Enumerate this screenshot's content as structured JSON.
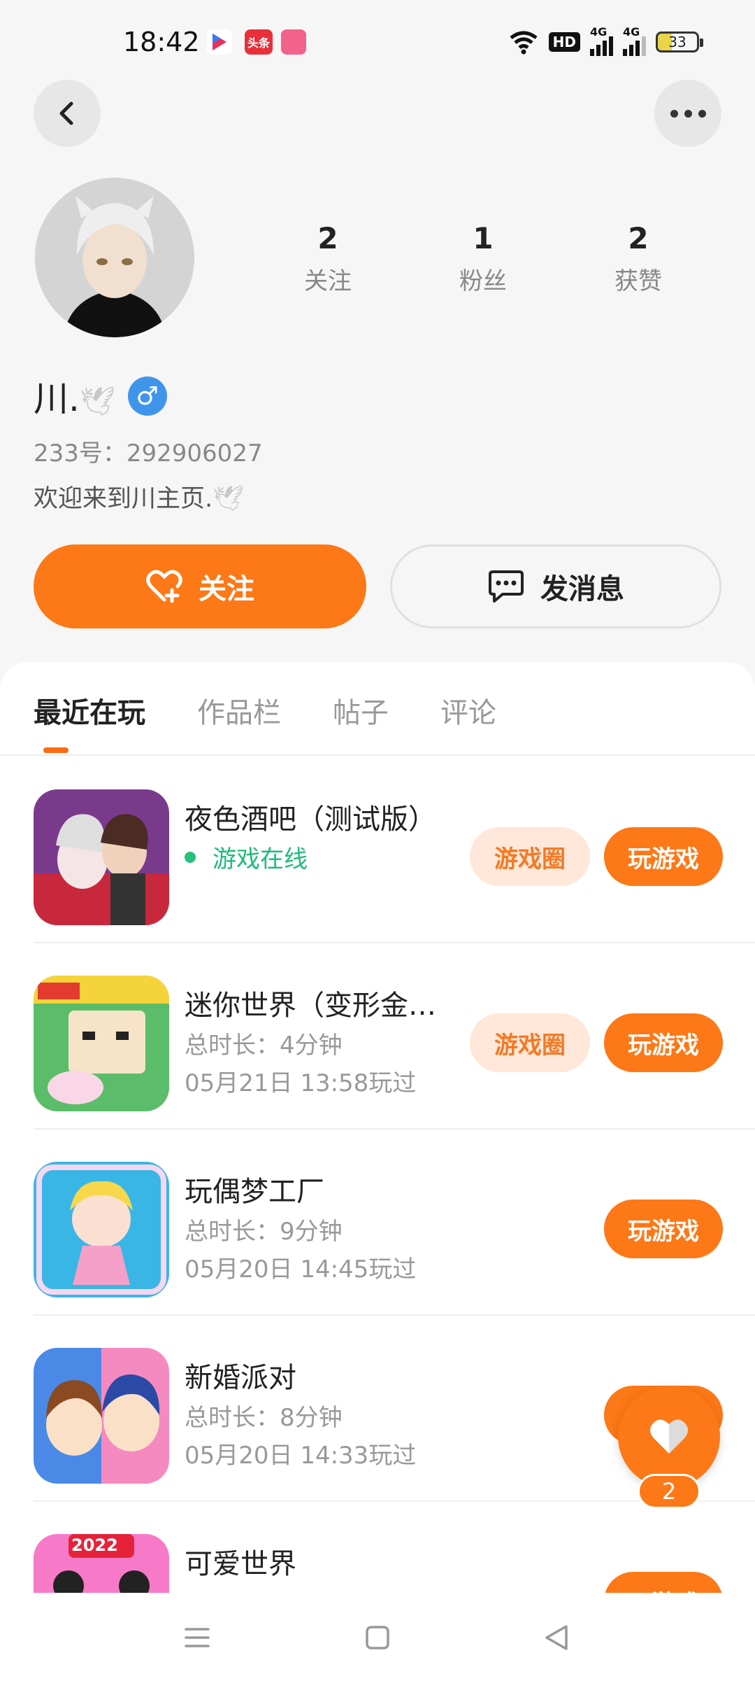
{
  "status_bar": {
    "time": "18:42",
    "app_icons": [
      "bilibili-app-icon",
      "toutiao-app-icon",
      "app-icon-pink"
    ],
    "toutiao_label": "头条",
    "hd_label": "HD",
    "network": "4G",
    "battery": "33"
  },
  "header": {
    "back_icon": "chevron-left-icon",
    "more_icon": "more-dots-icon"
  },
  "profile": {
    "stats": [
      {
        "num": "2",
        "label": "关注"
      },
      {
        "num": "1",
        "label": "粉丝"
      },
      {
        "num": "2",
        "label": "获赞"
      }
    ],
    "username": "川.",
    "gender_symbol": "♂",
    "uid": "233号：292906027",
    "bio": "欢迎来到川主页."
  },
  "actions": {
    "follow_label": "关注",
    "message_label": "发消息"
  },
  "tabs": [
    "最近在玩",
    "作品栏",
    "帖子",
    "评论"
  ],
  "games": [
    {
      "name": "夜色酒吧（测试版）",
      "status": "游戏在线",
      "duration": "",
      "last_played": "",
      "circle": "游戏圈",
      "play": "玩游戏"
    },
    {
      "name": "迷你世界（变形金…",
      "status": "",
      "duration": "总时长：4分钟",
      "last_played": "05月21日 13:58玩过",
      "circle": "游戏圈",
      "play": "玩游戏"
    },
    {
      "name": "玩偶梦工厂",
      "status": "",
      "duration": "总时长：9分钟",
      "last_played": "05月20日 14:45玩过",
      "circle": "",
      "play": "玩游戏"
    },
    {
      "name": "新婚派对",
      "status": "",
      "duration": "总时长：8分钟",
      "last_played": "05月20日 14:33玩过",
      "circle": "",
      "play": "玩游戏"
    },
    {
      "name": "可爱世界",
      "status": "",
      "duration": "",
      "last_played": "",
      "circle": "",
      "play": "玩游戏",
      "icon_badge": "2022"
    }
  ],
  "fab": {
    "count": "2"
  },
  "colors": {
    "accent": "#fd7816",
    "online": "#1fba7a",
    "gender": "#3f95ea"
  }
}
